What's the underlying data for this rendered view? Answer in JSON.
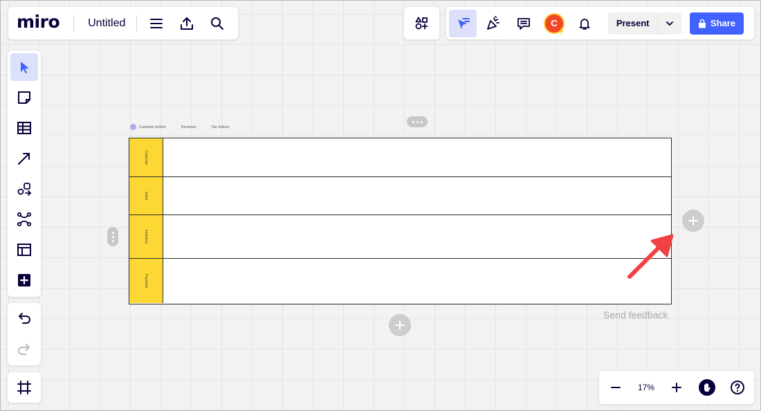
{
  "app": {
    "logo": "miro",
    "board_title": "Untitled"
  },
  "toolbar_top_right": {
    "avatar_initial": "C",
    "present_label": "Present",
    "share_label": "Share"
  },
  "canvas": {
    "legend": [
      "Customer actions",
      "Decisions",
      "Our actions"
    ],
    "lanes": [
      {
        "label": "Customer"
      },
      {
        "label": "Sales"
      },
      {
        "label": "Inventory"
      },
      {
        "label": "Payment"
      }
    ],
    "feedback_text": "Send feedback"
  },
  "zoom": {
    "level": "17%"
  },
  "colors": {
    "accent": "#4262ff",
    "lane_label": "#fdd835",
    "annotation_arrow": "#f24141"
  },
  "icons": {
    "top_left": [
      "menu-icon",
      "export-icon",
      "search-icon"
    ],
    "top_right": [
      "apps-icon",
      "select-cursor-icon",
      "celebrate-icon",
      "comment-icon",
      "notification-bell-icon",
      "lock-icon"
    ],
    "tools": [
      "select-icon",
      "sticky-note-icon",
      "table-icon",
      "connection-line-icon",
      "shapes-icon",
      "mind-map-icon",
      "templates-icon",
      "more-apps-icon"
    ],
    "history": [
      "undo-icon",
      "redo-icon"
    ],
    "frames": "frames-icon",
    "zoom": [
      "zoom-out-icon",
      "zoom-in-icon",
      "hand-icon",
      "help-icon"
    ]
  }
}
